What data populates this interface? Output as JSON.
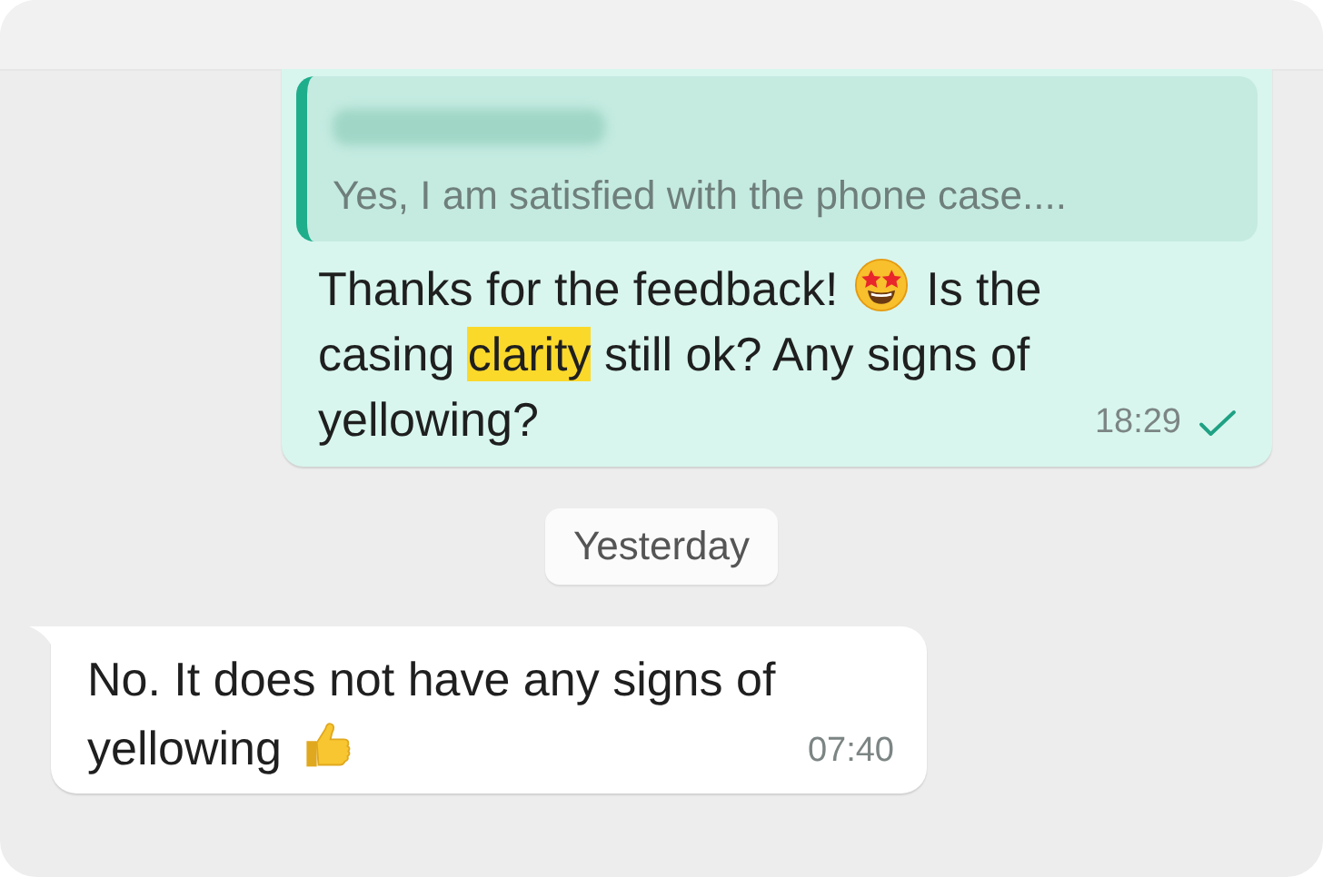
{
  "messages": [
    {
      "kind": "outgoing",
      "quote": {
        "author_blurred": true,
        "text": "Yes, I am satisfied with the phone case...."
      },
      "segments": [
        {
          "kind": "text",
          "text": "Thanks for the feedback! "
        },
        {
          "kind": "emoji_star_struck"
        },
        {
          "kind": "text",
          "text": " Is the casing "
        },
        {
          "kind": "highlight",
          "text": "clarity"
        },
        {
          "kind": "text",
          "text": " still ok? Any signs of yellowing?"
        }
      ],
      "time": "18:29",
      "read": true
    },
    {
      "kind": "date",
      "text": "Yesterday"
    },
    {
      "kind": "incoming",
      "segments": [
        {
          "kind": "text",
          "text": "No. It does not have any signs of yellowing "
        },
        {
          "kind": "emoji_thumbs_up"
        }
      ],
      "time": "07:40",
      "read": false
    }
  ]
}
